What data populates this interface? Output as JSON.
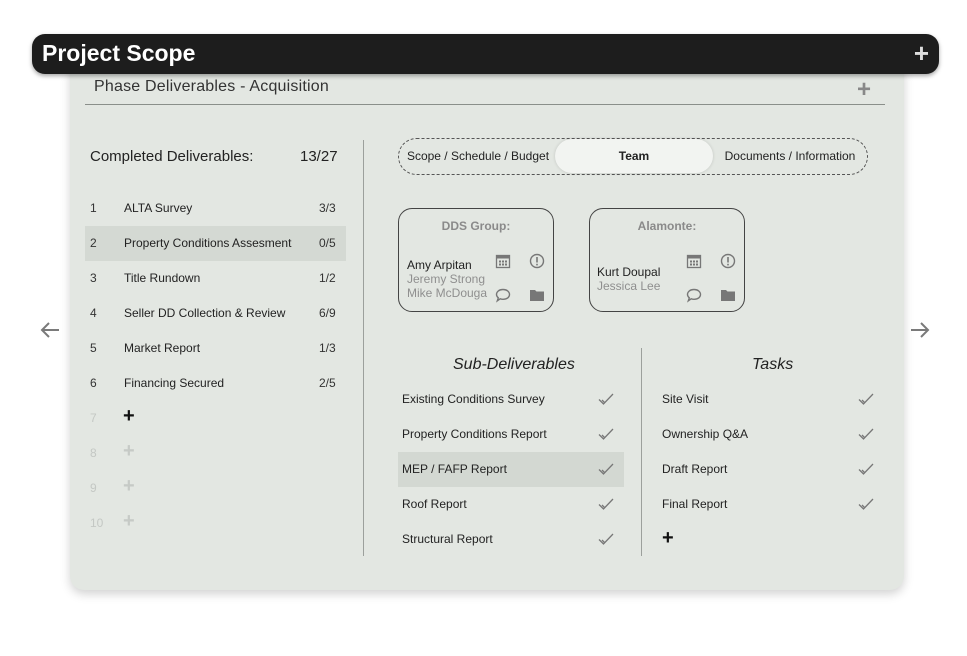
{
  "titlebar": {
    "title": "Project Scope"
  },
  "section": {
    "title": "Phase Deliverables - Acquisition"
  },
  "completed": {
    "label": "Completed Deliverables:",
    "count": "13/27"
  },
  "deliverables": [
    {
      "num": "1",
      "name": "ALTA Survey",
      "frac": "3/3"
    },
    {
      "num": "2",
      "name": "Property Conditions Assesment",
      "frac": "0/5"
    },
    {
      "num": "3",
      "name": "Title Rundown",
      "frac": "1/2"
    },
    {
      "num": "4",
      "name": "Seller DD Collection & Review",
      "frac": "6/9"
    },
    {
      "num": "5",
      "name": "Market Report",
      "frac": "1/3"
    },
    {
      "num": "6",
      "name": "Financing Secured",
      "frac": "2/5"
    },
    {
      "num": "7",
      "name": "",
      "frac": ""
    },
    {
      "num": "8",
      "name": "",
      "frac": ""
    },
    {
      "num": "9",
      "name": "",
      "frac": ""
    },
    {
      "num": "10",
      "name": "",
      "frac": ""
    }
  ],
  "tabs": [
    {
      "label": "Scope / Schedule / Budget"
    },
    {
      "label": "Team"
    },
    {
      "label": "Documents / Information"
    }
  ],
  "active_tab": "Team",
  "teams": [
    {
      "name": "DDS Group:",
      "members": [
        "Amy Arpitan",
        "Jeremy Strong",
        "Mike McDouga"
      ]
    },
    {
      "name": "Alamonte:",
      "members": [
        "Kurt Doupal",
        "Jessica Lee"
      ]
    }
  ],
  "sub_deliverables": {
    "heading": "Sub-Deliverables",
    "items": [
      "Existing Conditions Survey",
      "Property Conditions Report",
      "MEP / FAFP Report",
      "Roof Report",
      "Structural Report"
    ]
  },
  "tasks": {
    "heading": "Tasks",
    "items": [
      "Site Visit",
      "Ownership Q&A",
      "Draft Report",
      "Final Report"
    ]
  },
  "colors": {
    "titlebar": "#1d1d1d",
    "panel": "#e3e7e2",
    "highlight": "#d4d9d3"
  }
}
